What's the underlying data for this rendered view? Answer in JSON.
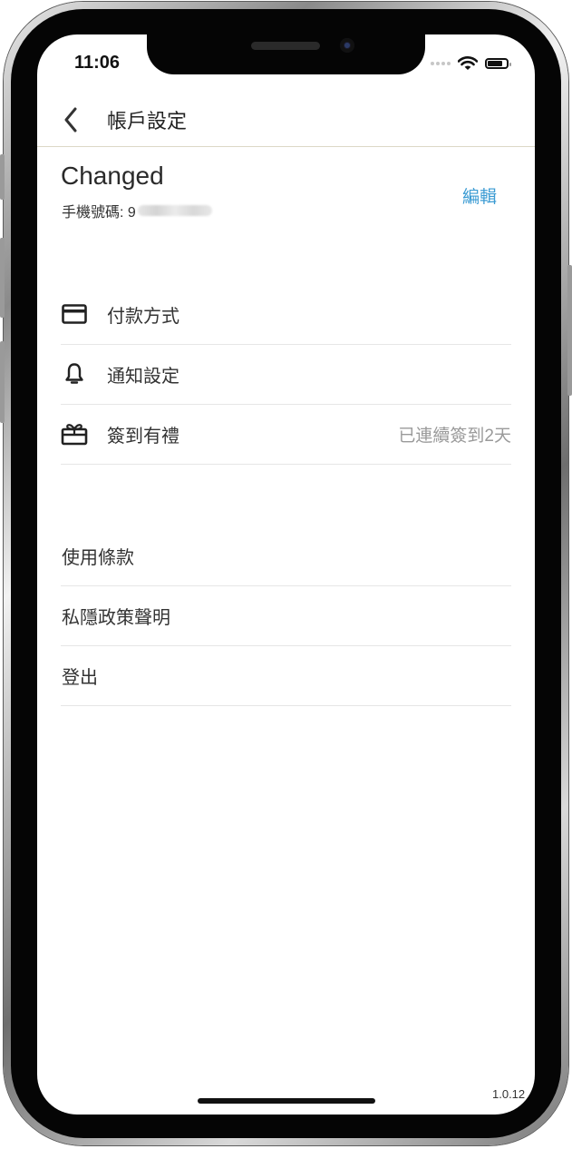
{
  "status_bar": {
    "time": "11:06"
  },
  "header": {
    "title": "帳戶設定"
  },
  "profile": {
    "name": "Changed",
    "phone_label": "手機號碼: 9",
    "edit_label": "編輯"
  },
  "menu_section_1": [
    {
      "label": "付款方式",
      "icon": "credit-card-icon"
    },
    {
      "label": "通知設定",
      "icon": "bell-icon"
    },
    {
      "label": "簽到有禮",
      "icon": "gift-icon",
      "detail": "已連續簽到2天"
    }
  ],
  "menu_section_2": [
    {
      "label": "使用條款"
    },
    {
      "label": "私隱政策聲明"
    },
    {
      "label": "登出"
    }
  ],
  "footer": {
    "version": "1.0.12"
  },
  "colors": {
    "accent": "#3b9bd3",
    "divider": "#e6e6e6"
  }
}
